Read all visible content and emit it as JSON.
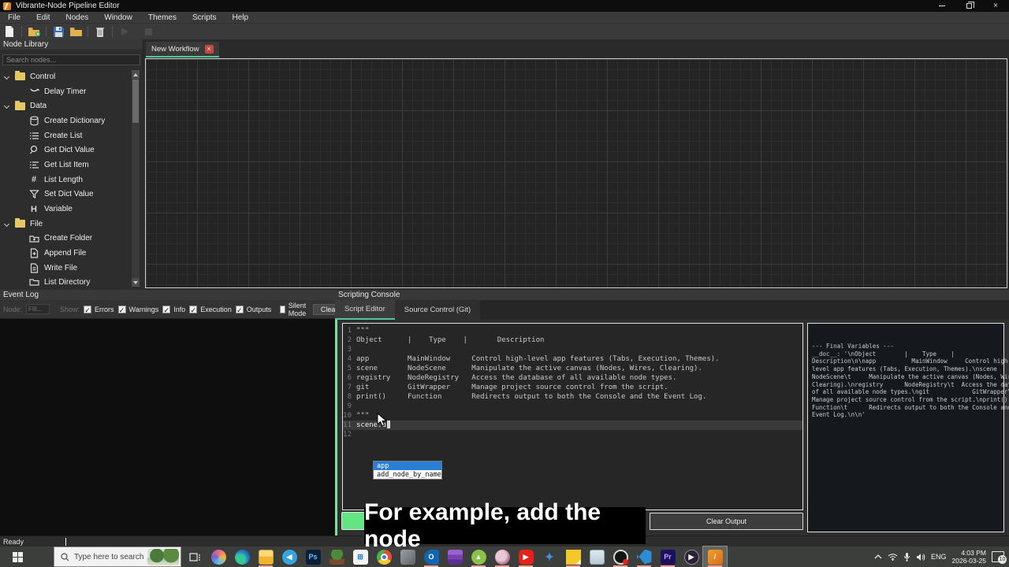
{
  "titlebar": {
    "title": "Vibrante-Node Pipeline Editor"
  },
  "menubar": [
    "File",
    "Edit",
    "Nodes",
    "Window",
    "Themes",
    "Scripts",
    "Help"
  ],
  "toolbar": {
    "icons": [
      "new-file",
      "open-project",
      "save",
      "open-folder",
      "delete",
      "run",
      "stop"
    ]
  },
  "node_library": {
    "title": "Node Library",
    "search_placeholder": "Search nodes...",
    "groups": [
      {
        "label": "Control",
        "icon": "folder-icon",
        "items": [
          {
            "label": "Delay Timer",
            "icon": "timer-icon"
          }
        ]
      },
      {
        "label": "Data",
        "icon": "folder-icon",
        "items": [
          {
            "label": "Create Dictionary",
            "icon": "database-icon"
          },
          {
            "label": "Create List",
            "icon": "list-icon"
          },
          {
            "label": "Get Dict Value",
            "icon": "search-small-icon"
          },
          {
            "label": "Get List Item",
            "icon": "list-item-icon"
          },
          {
            "label": "List Length",
            "icon": "hash-icon"
          },
          {
            "label": "Set Dict Value",
            "icon": "funnel-icon"
          },
          {
            "label": "Variable",
            "icon": "variable-icon"
          }
        ]
      },
      {
        "label": "File",
        "icon": "folder-icon",
        "items": [
          {
            "label": "Create Folder",
            "icon": "folder-plus-icon"
          },
          {
            "label": "Append File",
            "icon": "file-plus-icon"
          },
          {
            "label": "Write File",
            "icon": "file-text-icon"
          },
          {
            "label": "List Directory",
            "icon": "folder-open-icon"
          }
        ]
      }
    ]
  },
  "canvas": {
    "tab_label": "New Workflow"
  },
  "event_log": {
    "title": "Event Log",
    "node_label": "Node:",
    "filter_placeholder": "Filt...",
    "show_label": "Show:",
    "checkboxes": [
      {
        "label": "Errors",
        "checked": true
      },
      {
        "label": "Warnings",
        "checked": true
      },
      {
        "label": "Info",
        "checked": true
      },
      {
        "label": "Execution",
        "checked": true
      },
      {
        "label": "Outputs",
        "checked": true
      },
      {
        "label": "Silent Mode",
        "checked": false
      }
    ],
    "clear_label": "Clear",
    "check_glyph": "✓"
  },
  "console": {
    "title": "Scripting Console",
    "tabs": [
      "Script Editor",
      "Source Control (Git)"
    ],
    "editor": {
      "lines": [
        {
          "num": "1",
          "text": "\"\"\""
        },
        {
          "num": "2",
          "text": "Object      |    Type    |       Description"
        },
        {
          "num": "3",
          "text": ""
        },
        {
          "num": "4",
          "text": "app         MainWindow     Control high-level app features (Tabs, Execution, Themes)."
        },
        {
          "num": "5",
          "text": "scene       NodeScene      Manipulate the active canvas (Nodes, Wires, Clearing)."
        },
        {
          "num": "6",
          "text": "registry    NodeRegistry   Access the database of all available node types."
        },
        {
          "num": "7",
          "text": "git         GitWrapper     Manage project source control from the script."
        },
        {
          "num": "8",
          "text": "print()     Function       Redirects output to both the Console and the Event Log."
        },
        {
          "num": "9",
          "text": ""
        },
        {
          "num": "10",
          "text": "\"\"\""
        },
        {
          "num": "11",
          "text": "scene.a"
        },
        {
          "num": "12",
          "text": ""
        }
      ]
    },
    "autocomplete": {
      "items": [
        "app",
        "add_node_by_name"
      ],
      "selected_index": 0
    },
    "output_text": "--- Final Variables ---\n__doc__: '\\nObject        |    Type    |\nDescription\\n\\napp          MainWindow     Control high-\nlevel app features (Tabs, Execution, Themes).\\nscene\nNodeScene\\t     Manipulate the active canvas (Nodes, Wires,\nClearing).\\nregistry      NodeRegistry\\t  Access the database\nof all available node types.\\ngit            GitWrapper\\t\nManage project source control from the script.\\nprint()\nFunction\\t      Redirects output to both the Console and the\nEvent Log.\\n\\n'",
    "clear_output_label": "Clear Output"
  },
  "caption": {
    "text": "For example, add the node"
  },
  "status": {
    "text": "Ready"
  },
  "taskbar": {
    "search_placeholder": "Type here to search",
    "language": "ENG",
    "time": "4:03 PM",
    "date": "2026-03-25",
    "notification_count": "10",
    "colors": {
      "accent_green": "#56c596",
      "run_button": "#63e584",
      "selection_blue": "#2a7fd4"
    }
  }
}
